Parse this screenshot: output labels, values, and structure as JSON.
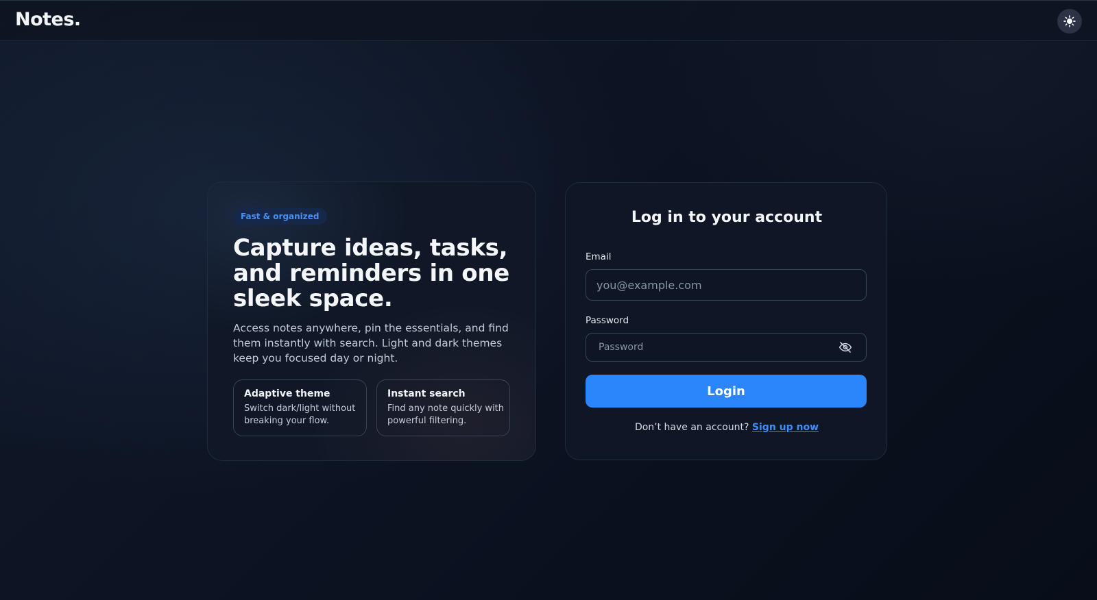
{
  "header": {
    "logo": "Notes.",
    "theme_toggle_icon": "sun-icon"
  },
  "hero": {
    "badge": "Fast & organized",
    "title": "Capture ideas, tasks, and reminders in one sleek space.",
    "description": "Access notes anywhere, pin the essentials, and find them instantly with search. Light and dark themes keep you focused day or night.",
    "features": [
      {
        "title": "Adaptive theme",
        "description": "Switch dark/light without breaking your flow."
      },
      {
        "title": "Instant search",
        "description": "Find any note quickly with powerful filtering."
      }
    ]
  },
  "login": {
    "title": "Log in to your account",
    "email_label": "Email",
    "email_placeholder": "you@example.com",
    "password_label": "Password",
    "password_placeholder": "Password",
    "password_toggle_icon": "eye-off-icon",
    "button_label": "Login",
    "signup_prompt": "Don’t have an account?",
    "signup_link": "Sign up now"
  },
  "colors": {
    "accent": "#2b86fb",
    "badge_text": "#4a8ff5",
    "background": "#0c1322"
  }
}
